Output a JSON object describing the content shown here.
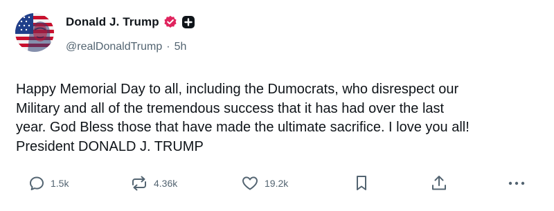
{
  "author": {
    "display_name": "Donald J. Trump",
    "handle": "@realDonaldTrump",
    "separator": "·",
    "time_ago": "5h",
    "verified_color": "#e0245e"
  },
  "post": {
    "lines": [
      "Happy Memorial Day to all, including the Dumocrats, who disrespect our",
      "Military and all of the tremendous success that it has had over the last",
      "year. God Bless those that have made the ultimate sacrifice. I love you all!",
      "President DONALD J. TRUMP"
    ]
  },
  "actions": {
    "replies": "1.5k",
    "reposts": "4.36k",
    "likes": "19.2k",
    "icons": [
      "reply-icon",
      "repost-icon",
      "like-icon",
      "bookmark-icon",
      "share-icon",
      "more-icon"
    ]
  },
  "colors": {
    "text": "#0f1419",
    "muted": "#536471",
    "icon": "#536471"
  }
}
